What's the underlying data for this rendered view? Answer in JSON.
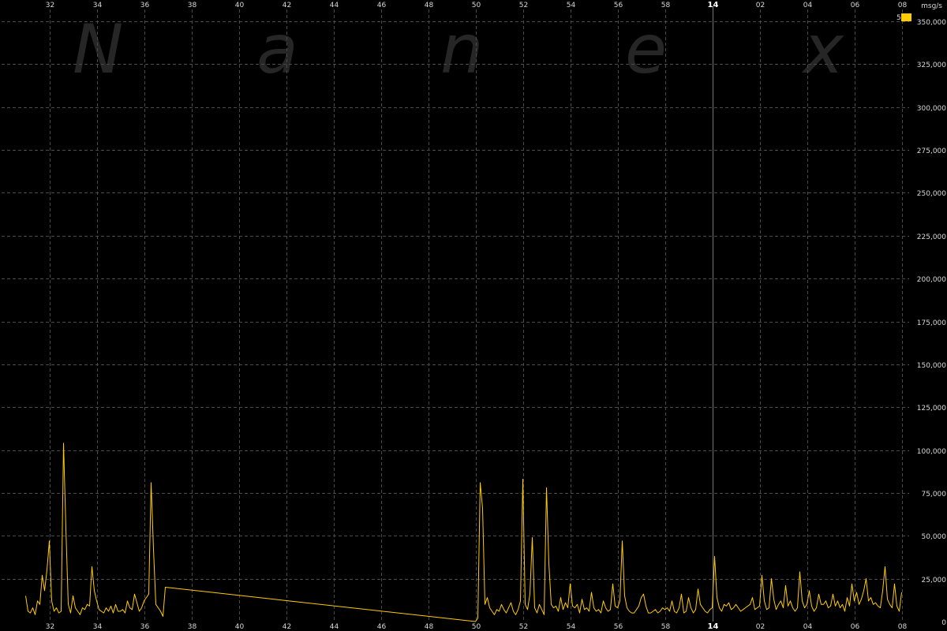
{
  "colors": {
    "background": "#000000",
    "grid": "#4a4a4a",
    "series": "#ffcc00",
    "text": "#d8d8d8",
    "watermark": "#262626",
    "day_divider": "#777777"
  },
  "watermark": {
    "letters": [
      "N",
      "a",
      "n",
      "e",
      "x"
    ]
  },
  "chart_data": {
    "type": "line",
    "title": "",
    "xlabel": "",
    "ylabel": "msg/s",
    "y_unit_label": "msg/s",
    "ylim": [
      0,
      350000
    ],
    "xlim_minutes": [
      0,
      46.5
    ],
    "grid": true,
    "legend": {
      "placement": "top-right",
      "entries": [
        {
          "label": "5",
          "color": "#ffcc00"
        }
      ]
    },
    "x_ticks": [
      {
        "minute": 1,
        "label": "32",
        "day_marker": false
      },
      {
        "minute": 3,
        "label": "34",
        "day_marker": false
      },
      {
        "minute": 5,
        "label": "36",
        "day_marker": false
      },
      {
        "minute": 7,
        "label": "38",
        "day_marker": false
      },
      {
        "minute": 9,
        "label": "40",
        "day_marker": false
      },
      {
        "minute": 11,
        "label": "42",
        "day_marker": false
      },
      {
        "minute": 13,
        "label": "44",
        "day_marker": false
      },
      {
        "minute": 15,
        "label": "46",
        "day_marker": false
      },
      {
        "minute": 17,
        "label": "48",
        "day_marker": false
      },
      {
        "minute": 19,
        "label": "50",
        "day_marker": false
      },
      {
        "minute": 21,
        "label": "52",
        "day_marker": false
      },
      {
        "minute": 23,
        "label": "54",
        "day_marker": false
      },
      {
        "minute": 25,
        "label": "56",
        "day_marker": false
      },
      {
        "minute": 27,
        "label": "58",
        "day_marker": false
      },
      {
        "minute": 29,
        "label": "14",
        "day_marker": true
      },
      {
        "minute": 31,
        "label": "02",
        "day_marker": false
      },
      {
        "minute": 33,
        "label": "04",
        "day_marker": false
      },
      {
        "minute": 35,
        "label": "06",
        "day_marker": false
      },
      {
        "minute": 37,
        "label": "08",
        "day_marker": false
      }
    ],
    "y_ticks": [
      {
        "value": 0,
        "label": "0"
      },
      {
        "value": 25000,
        "label": "25,000"
      },
      {
        "value": 50000,
        "label": "50,000"
      },
      {
        "value": 75000,
        "label": "75,000"
      },
      {
        "value": 100000,
        "label": "100,000"
      },
      {
        "value": 125000,
        "label": "125,000"
      },
      {
        "value": 150000,
        "label": "150,000"
      },
      {
        "value": 175000,
        "label": "175,000"
      },
      {
        "value": 200000,
        "label": "200,000"
      },
      {
        "value": 225000,
        "label": "225,000"
      },
      {
        "value": 250000,
        "label": "250,000"
      },
      {
        "value": 275000,
        "label": "275,000"
      },
      {
        "value": 300000,
        "label": "300,000"
      },
      {
        "value": 325000,
        "label": "325,000"
      },
      {
        "value": 350000,
        "label": "350,000"
      }
    ],
    "series": [
      {
        "name": "5",
        "color": "#ffcc00",
        "x_minutes": [
          0,
          0.1,
          0.2,
          0.3,
          0.4,
          0.5,
          0.6,
          0.7,
          0.8,
          0.9,
          1.0,
          1.1,
          1.2,
          1.3,
          1.4,
          1.5,
          1.6,
          1.7,
          1.8,
          1.9,
          2.0,
          2.1,
          2.2,
          2.3,
          2.4,
          2.5,
          2.6,
          2.7,
          2.8,
          2.9,
          3.0,
          3.1,
          3.2,
          3.3,
          3.4,
          3.5,
          3.6,
          3.7,
          3.8,
          3.9,
          4.0,
          4.1,
          4.2,
          4.3,
          4.4,
          4.5,
          4.6,
          4.7,
          4.8,
          4.9,
          5.0,
          5.1,
          5.2,
          5.3,
          5.4,
          5.5,
          5.6,
          5.7,
          5.8,
          5.9,
          19.0,
          19.1,
          19.2,
          19.3,
          19.4,
          19.5,
          19.6,
          19.7,
          19.8,
          19.9,
          20.0,
          20.1,
          20.2,
          20.3,
          20.4,
          20.5,
          20.6,
          20.7,
          20.8,
          20.9,
          21.0,
          21.1,
          21.2,
          21.3,
          21.4,
          21.5,
          21.6,
          21.7,
          21.8,
          21.9,
          22.0,
          22.1,
          22.2,
          22.3,
          22.4,
          22.5,
          22.6,
          22.7,
          22.8,
          22.9,
          23.0,
          23.1,
          23.2,
          23.3,
          23.4,
          23.5,
          23.6,
          23.7,
          23.8,
          23.9,
          24.0,
          24.1,
          24.2,
          24.3,
          24.4,
          24.5,
          24.6,
          24.7,
          24.8,
          24.9,
          25.0,
          25.1,
          25.2,
          25.3,
          25.4,
          25.5,
          25.6,
          25.7,
          25.8,
          25.9,
          26.0,
          26.1,
          26.2,
          26.3,
          26.4,
          26.5,
          26.6,
          26.7,
          26.8,
          26.9,
          27.0,
          27.1,
          27.2,
          27.3,
          27.4,
          27.5,
          27.6,
          27.7,
          27.8,
          27.9,
          28.0,
          28.1,
          28.2,
          28.3,
          28.4,
          28.5,
          28.6,
          28.7,
          28.8,
          28.9,
          29.0,
          29.1,
          29.2,
          29.3,
          29.4,
          29.5,
          29.6,
          29.7,
          29.8,
          29.9,
          30.0,
          30.1,
          30.2,
          30.3,
          30.4,
          30.5,
          30.6,
          30.7,
          30.8,
          30.9,
          31.0,
          31.1,
          31.2,
          31.3,
          31.4,
          31.5,
          31.6,
          31.7,
          31.8,
          31.9,
          32.0,
          32.1,
          32.2,
          32.3,
          32.4,
          32.5,
          32.6,
          32.7,
          32.8,
          32.9,
          33.0,
          33.1,
          33.2,
          33.3,
          33.4,
          33.5,
          33.6,
          33.7,
          33.8,
          33.9,
          34.0,
          34.1,
          34.2,
          34.3,
          34.4,
          34.5,
          34.6,
          34.7,
          34.8,
          34.9,
          35.0,
          35.1,
          35.2,
          35.3,
          35.4,
          35.5,
          35.6,
          35.7,
          35.8,
          35.9,
          36.0,
          36.1,
          36.2,
          36.3,
          36.4,
          36.5,
          36.6,
          36.7,
          36.8,
          36.9,
          37.0,
          37.1,
          37.2,
          37.3,
          37.4
        ],
        "values": [
          15000,
          6000,
          5000,
          8000,
          4000,
          12000,
          10000,
          27000,
          18000,
          30000,
          47000,
          12000,
          6000,
          8000,
          5000,
          6000,
          104000,
          54000,
          10000,
          5000,
          15000,
          8000,
          6000,
          4000,
          8000,
          7000,
          10000,
          9000,
          32000,
          18000,
          12000,
          7000,
          6000,
          5000,
          8000,
          6000,
          9000,
          5000,
          10000,
          6000,
          6000,
          7000,
          5000,
          12000,
          8000,
          7000,
          16000,
          11000,
          6000,
          8000,
          12000,
          14000,
          16000,
          81000,
          42000,
          10000,
          8000,
          6000,
          3000,
          20000,
          0,
          2000,
          81000,
          66000,
          10000,
          14000,
          8000,
          6000,
          4000,
          7000,
          6000,
          10000,
          7000,
          5000,
          8000,
          11000,
          6000,
          4000,
          7000,
          12000,
          83000,
          10000,
          7000,
          16000,
          49000,
          8000,
          5000,
          10000,
          7000,
          4000,
          78000,
          34000,
          10000,
          8000,
          9000,
          6000,
          14000,
          7000,
          11000,
          8000,
          22000,
          9000,
          8000,
          10000,
          5000,
          13000,
          7000,
          8000,
          6000,
          17000,
          8000,
          6000,
          7000,
          5000,
          12000,
          8000,
          6000,
          7000,
          22000,
          9000,
          8000,
          12000,
          47000,
          15000,
          8000,
          6000,
          5000,
          5000,
          7000,
          9000,
          14000,
          16000,
          9000,
          5000,
          5000,
          6000,
          7000,
          5000,
          6000,
          8000,
          7000,
          8000,
          6000,
          12000,
          6000,
          5000,
          8000,
          16000,
          5000,
          6000,
          14000,
          8000,
          5000,
          7000,
          19000,
          10000,
          8000,
          6000,
          5000,
          7000,
          8000,
          38000,
          14000,
          8000,
          6000,
          10000,
          9000,
          11000,
          7000,
          8000,
          10000,
          8000,
          6000,
          7000,
          8000,
          9000,
          10000,
          14000,
          7000,
          8000,
          9000,
          27000,
          12000,
          7000,
          8000,
          25000,
          13000,
          7000,
          10000,
          12000,
          8000,
          21000,
          9000,
          12000,
          8000,
          6000,
          8000,
          29000,
          12000,
          8000,
          10000,
          18000,
          9000,
          6000,
          8000,
          16000,
          10000,
          10000,
          12000,
          8000,
          9000,
          16000,
          9000,
          12000,
          8000,
          10000,
          6000,
          14000,
          9000,
          22000,
          12000,
          17000,
          10000,
          13000,
          18000,
          25000,
          12000,
          14000,
          10000,
          11000,
          9000,
          8000,
          18000,
          32000,
          13000,
          10000,
          8000,
          22000,
          9000,
          6000,
          17000
        ]
      }
    ]
  }
}
